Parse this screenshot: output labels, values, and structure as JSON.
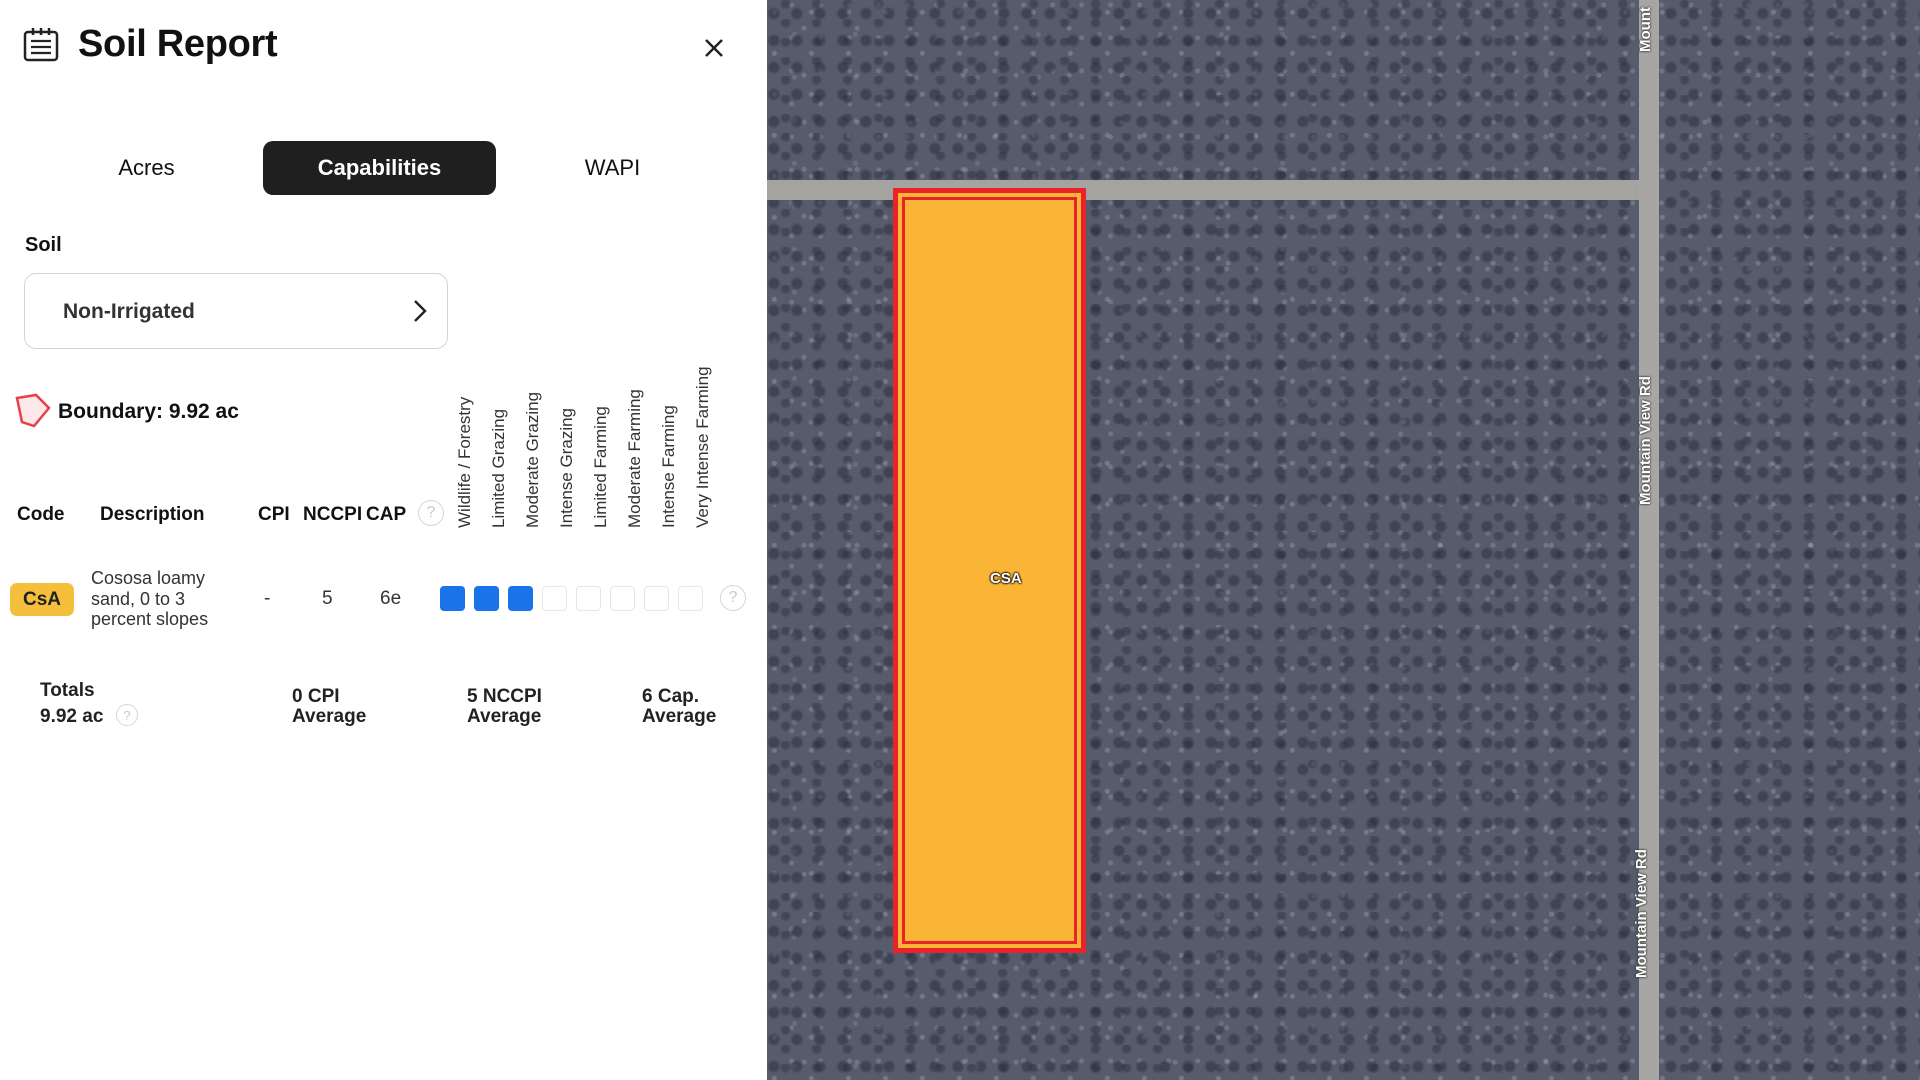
{
  "header": {
    "title": "Soil Report",
    "icon": "report-icon",
    "close_icon": "close-icon"
  },
  "tabs": [
    {
      "label": "Acres",
      "active": false
    },
    {
      "label": "Capabilities",
      "active": true
    },
    {
      "label": "WAPI",
      "active": false
    }
  ],
  "soil": {
    "label": "Soil",
    "selected": "Non-Irrigated"
  },
  "boundary": {
    "text": "Boundary: 9.92 ac",
    "icon": "polygon-icon"
  },
  "capability_headers": [
    "Wildlife / Forestry",
    "Limited Grazing",
    "Moderate Grazing",
    "Intense Grazing",
    "Limited Farming",
    "Moderate Farming",
    "Intense Farming",
    "Very Intense Farming"
  ],
  "table": {
    "columns": [
      "Code",
      "Description",
      "CPI",
      "NCCPI",
      "CAP"
    ],
    "rows": [
      {
        "code": "CsA",
        "description": "Cososa loamy sand, 0 to 3 percent slopes",
        "cpi": "-",
        "nccpi": "5",
        "cap": "6e",
        "capability_filled": 3,
        "capability_total": 8
      }
    ]
  },
  "totals": {
    "label": "Totals",
    "acres": "9.92 ac",
    "cpi_value": "0 CPI",
    "cpi_suffix": "Average",
    "nccpi_value": "5 NCCPI",
    "nccpi_suffix": "Average",
    "cap_value": "6 Cap.",
    "cap_suffix": "Average"
  },
  "map": {
    "parcel_label": "CSA",
    "road_top_label": "Mount",
    "road_label_1": "Mountain View Rd",
    "road_label_2": "Mountain View Rd"
  },
  "colors": {
    "active_tab": "#1f1f1f",
    "code_badge": "#f6bf3b",
    "capability_on": "#1a73e8",
    "parcel_fill": "#fbb536",
    "parcel_border": "#e8232a"
  }
}
